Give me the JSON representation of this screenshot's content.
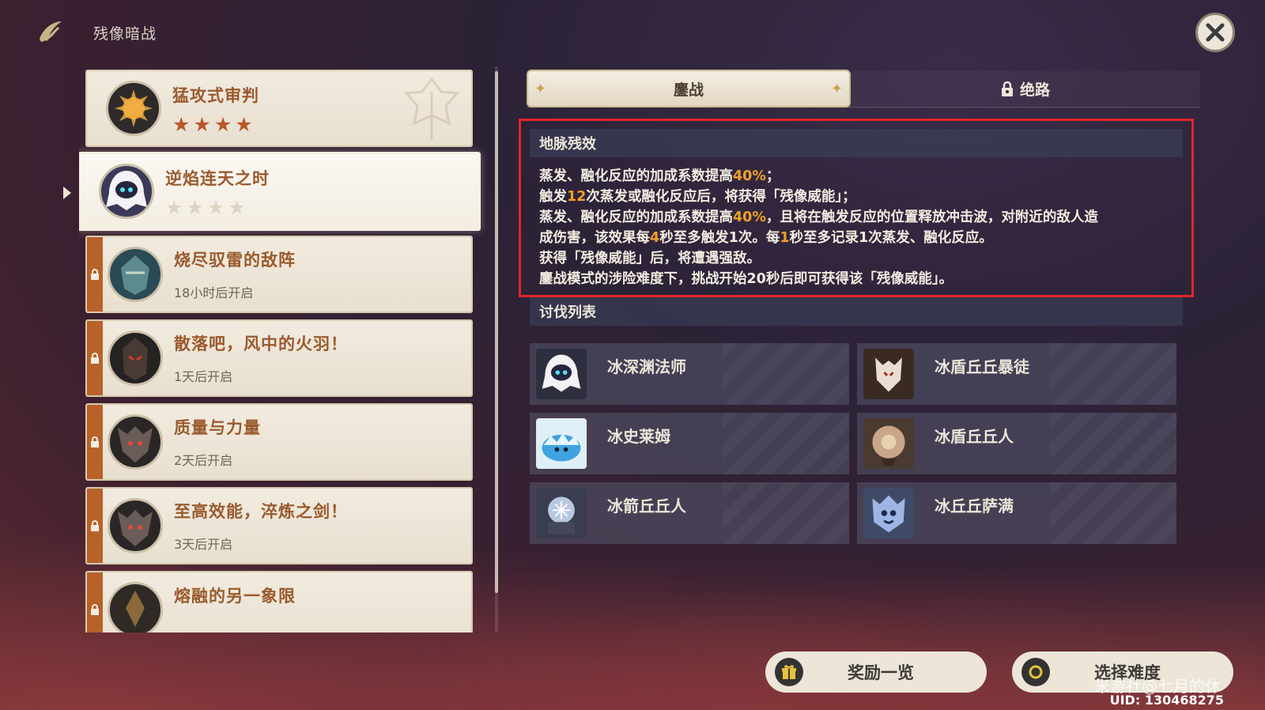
{
  "header": {
    "title": "残像暗战",
    "logo_icon": "feather-sword-icon",
    "close_icon": "close-x-icon"
  },
  "challenges": [
    {
      "name": "猛攻式审判",
      "stars_filled": 4,
      "stars_total": 4,
      "locked": false,
      "status": ""
    },
    {
      "name": "逆焰连天之时",
      "stars_filled": 0,
      "stars_total": 4,
      "locked": false,
      "status": "",
      "selected": true
    },
    {
      "name": "烧尽驭雷的敌阵",
      "locked": true,
      "status": "18小时后开启"
    },
    {
      "name": "散落吧，风中的火羽！",
      "locked": true,
      "status": "1天后开启"
    },
    {
      "name": "质量与力量",
      "locked": true,
      "status": "2天后开启"
    },
    {
      "name": "至高效能，淬炼之剑！",
      "locked": true,
      "status": "3天后开启"
    },
    {
      "name": "熔融的另一象限",
      "locked": true,
      "status": ""
    }
  ],
  "tabs": {
    "active": "鏖战",
    "other": "绝路"
  },
  "effect": {
    "title": "地脉残效",
    "lines": [
      {
        "pre": "蒸发、融化反应的加成系数提高",
        "hl": "40%",
        "post": "；"
      },
      {
        "pre": "触发",
        "hl": "12",
        "post": "次蒸发或融化反应后，将获得「残像威能」；"
      },
      {
        "pre": "蒸发、融化反应的加成系数提高",
        "hl": "40%",
        "post": "，且将在触发反应的位置释放冲击波，对附近的敌人造"
      },
      {
        "pre": "成伤害，该效果每",
        "hl": "4",
        "post": "秒至多触发1次。每",
        "hl2": "1",
        "post2": "秒至多记录1次蒸发、融化反应。"
      },
      {
        "pre": "获得「残像威能」后，将遭遇强敌。",
        "hl": "",
        "post": ""
      },
      {
        "pre": "鏖战模式的涉险难度下，挑战开始20秒后即可获得该「残像威能」。",
        "hl": "",
        "post": ""
      }
    ]
  },
  "enemies": {
    "title": "讨伐列表",
    "items": [
      "冰深渊法师",
      "冰盾丘丘暴徒",
      "冰史莱姆",
      "冰盾丘丘人",
      "冰箭丘丘人",
      "冰丘丘萨满"
    ]
  },
  "buttons": {
    "rewards": "奖励一览",
    "difficulty": "选择难度"
  },
  "footer": {
    "watermark": "米游社@七月的休",
    "uid": "UID: 130468275"
  },
  "colors": {
    "accent_orange": "#f0a02a",
    "card_bg": "#ece5d8",
    "highlight_border": "#e0262a",
    "lock_bar": "#b8622a"
  }
}
